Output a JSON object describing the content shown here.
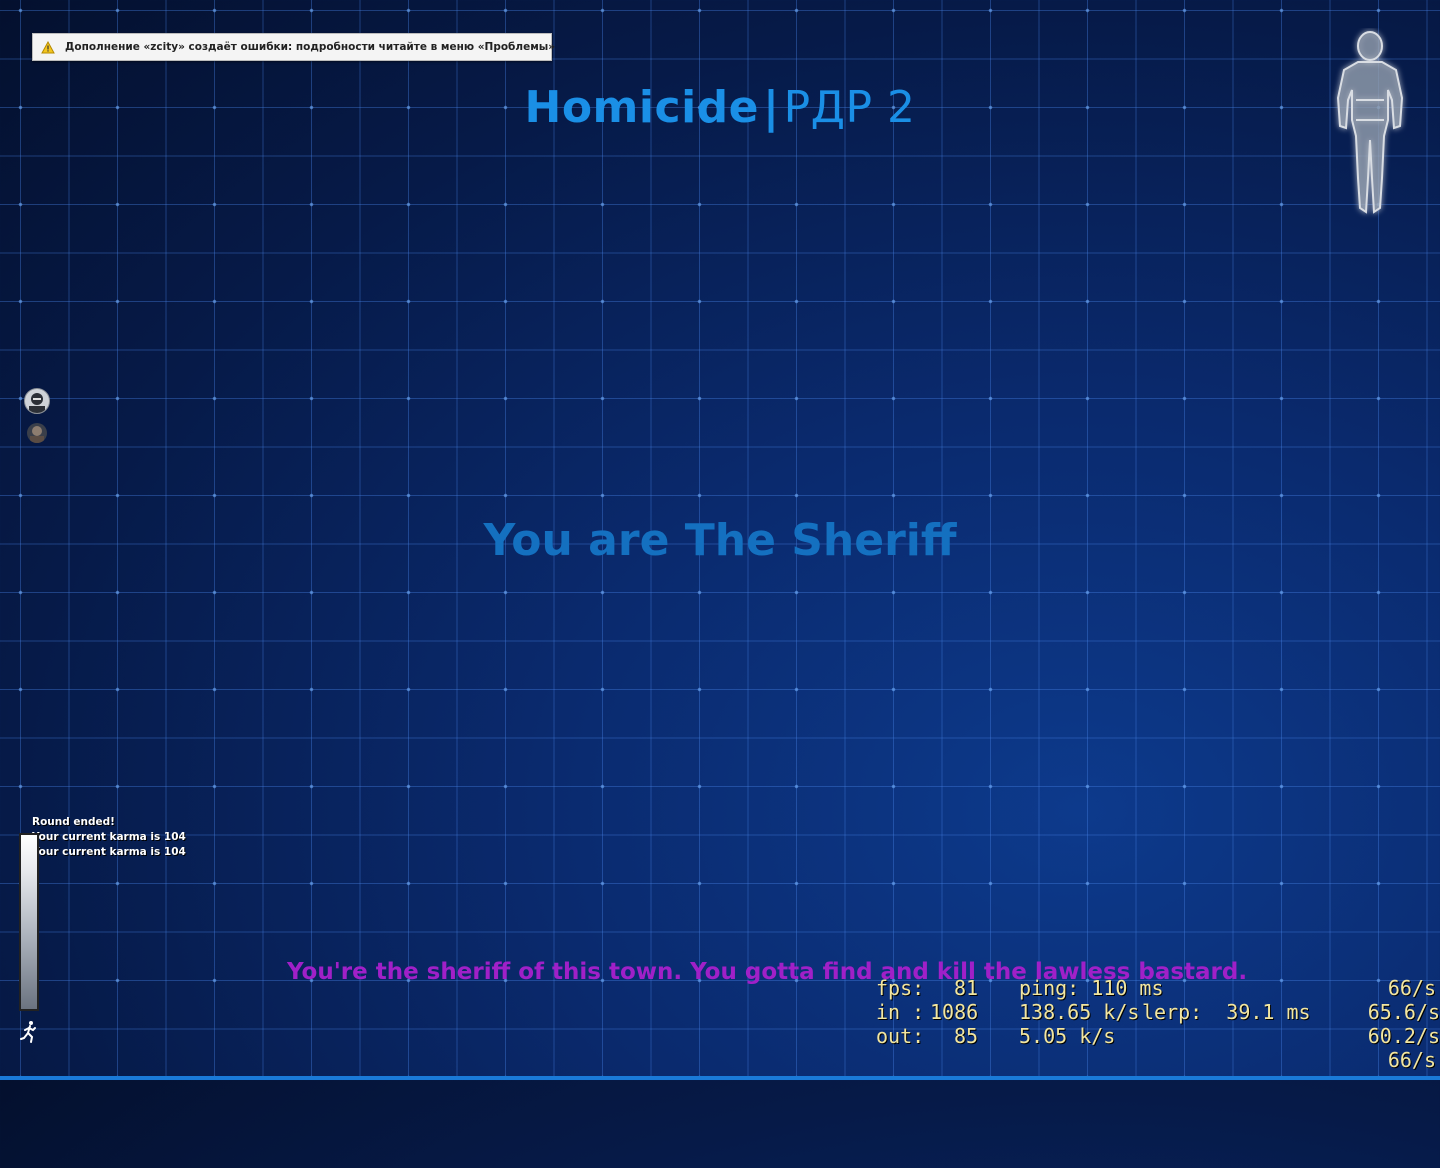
{
  "notice": {
    "icon": "warning-icon",
    "text": "Дополнение «zcity» создаёт ошибки: подробности читайте в меню «Проблемы»"
  },
  "header": {
    "mode": "Homicide",
    "separator": "|",
    "map": "РДР 2"
  },
  "role_text": "You are The Sheriff",
  "chat": {
    "lines": [
      "Round ended!",
      "Your current karma is 104",
      "Your current karma is 104"
    ]
  },
  "objective": "You're the sheriff of this town. You gotta find and kill the lawless bastard.",
  "netgraph": {
    "row1": {
      "fps_label": "fps:",
      "fps": "81",
      "ping": "ping: 110 ms",
      "rate": "66/s"
    },
    "row2": {
      "in_label": "in :",
      "in": "1086",
      "in_kbs": "138.65 k/s",
      "lerp": "lerp:  39.1 ms",
      "rate": "65.6/s"
    },
    "row3": {
      "out_label": "out:",
      "out": "85",
      "out_kbs": "5.05 k/s",
      "rate": "60.2/s"
    },
    "row4": {
      "rate": "66/s"
    }
  },
  "colors": {
    "title": "#1a8fe6",
    "role": "#1470c0",
    "objective": "#a020c8",
    "netgraph": "#f2e6a0",
    "background": "#0a2a6e"
  },
  "icons": [
    "warning-icon",
    "body-health-icon",
    "player-avatar-icon",
    "stamina-run-icon"
  ]
}
